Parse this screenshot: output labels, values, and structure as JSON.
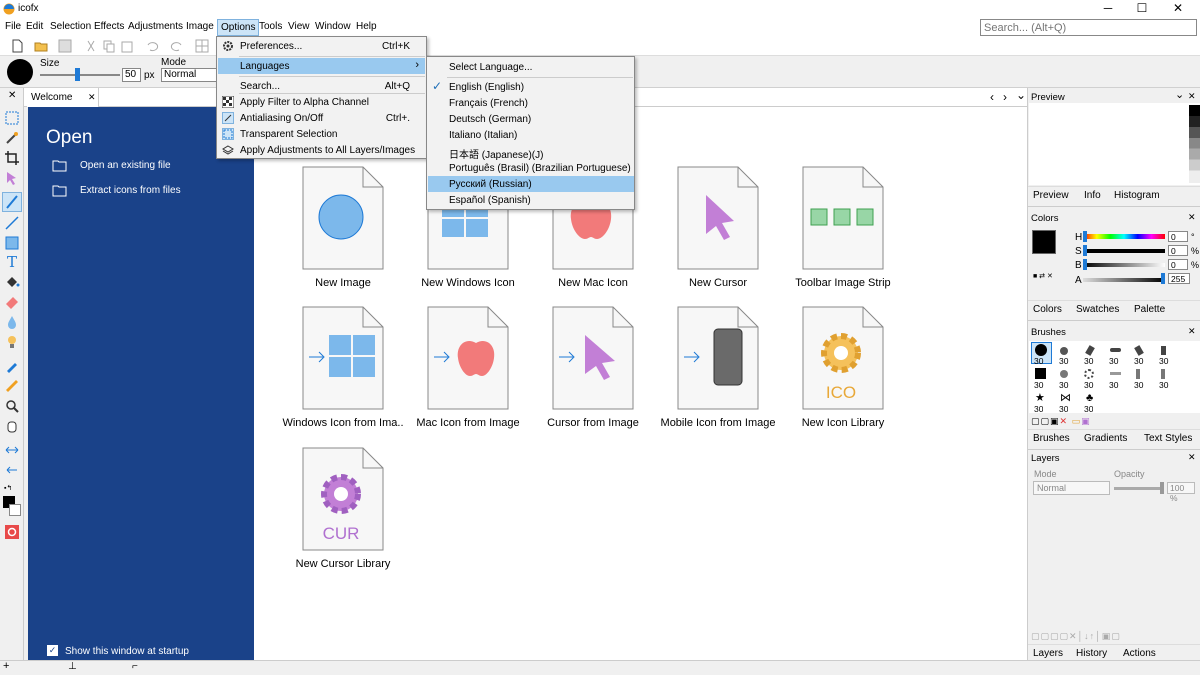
{
  "app": {
    "title": "icofx"
  },
  "window_controls": {
    "minimize": "─",
    "maximize": "☐",
    "close": "✕"
  },
  "menu": [
    "File",
    "Edit",
    "Selection",
    "Effects",
    "Adjustments",
    "Image",
    "Options",
    "Tools",
    "View",
    "Window",
    "Help"
  ],
  "search": {
    "placeholder": "Search... (Alt+Q)"
  },
  "props": {
    "size_label": "Size",
    "size_value": "50",
    "size_unit": "px",
    "mode_label": "Mode",
    "mode_value": "Normal"
  },
  "tabs": {
    "welcome": "Welcome",
    "welcome_close": "✕",
    "nav_left": "‹",
    "nav_right": "›",
    "nav_down": "⌄"
  },
  "sidebar": {
    "heading": "Open",
    "open_existing": "Open an existing file",
    "extract_icons": "Extract icons from files",
    "startup_label": "Show this window at startup",
    "startup_checked": true
  },
  "cards": [
    {
      "label": "New Image",
      "icon": "circle-icon"
    },
    {
      "label": "New Windows Icon",
      "icon": "windows-logo-icon"
    },
    {
      "label": "New Mac Icon",
      "icon": "apple-logo-icon"
    },
    {
      "label": "New Cursor",
      "icon": "cursor-icon"
    },
    {
      "label": "Toolbar Image Strip",
      "icon": "strip-icon"
    },
    {
      "label": "Windows Icon from Ima..",
      "icon": "windows-from-image-icon"
    },
    {
      "label": "Mac Icon from Image",
      "icon": "apple-from-image-icon"
    },
    {
      "label": "Cursor from Image",
      "icon": "cursor-from-image-icon"
    },
    {
      "label": "Mobile Icon from Image",
      "icon": "mobile-from-image-icon"
    },
    {
      "label": "New Icon Library",
      "icon": "ico-gear-icon"
    },
    {
      "label": "New Cursor Library",
      "icon": "cur-gear-icon"
    }
  ],
  "library_tags": {
    "ico": "ICO",
    "cur": "CUR"
  },
  "options_menu": [
    {
      "label": "Preferences...",
      "shortcut": "Ctrl+K",
      "icon": "gear-icon"
    },
    {
      "label": "Languages",
      "shortcut": "›",
      "icon": ""
    },
    {
      "label": "Search...",
      "shortcut": "Alt+Q",
      "icon": ""
    },
    {
      "label": "Apply Filter to Alpha Channel",
      "shortcut": "",
      "icon": "checker-icon"
    },
    {
      "label": "Antialiasing On/Off",
      "shortcut": "Ctrl+.",
      "icon": "antialias-icon"
    },
    {
      "label": "Transparent Selection",
      "shortcut": "",
      "icon": "transparent-selection-icon"
    },
    {
      "label": "Apply Adjustments to All Layers/Images",
      "shortcut": "",
      "icon": "layers-icon"
    }
  ],
  "languages_menu": [
    {
      "label": "Select Language...",
      "checked": false
    },
    {
      "label": "English (English)",
      "checked": true
    },
    {
      "label": "Français (French)",
      "checked": false
    },
    {
      "label": "Deutsch (German)",
      "checked": false
    },
    {
      "label": "Italiano (Italian)",
      "checked": false
    },
    {
      "label": "日本語 (Japanese)(J)",
      "checked": false
    },
    {
      "label": "Português (Brasil) (Brazilian Portuguese)",
      "checked": false
    },
    {
      "label": "Русский (Russian)",
      "checked": false
    },
    {
      "label": "Español (Spanish)",
      "checked": false
    }
  ],
  "right_panel": {
    "preview_title": "Preview",
    "preview_tabs": [
      "Preview",
      "Info",
      "Histogram"
    ],
    "colors_title": "Colors",
    "channels": [
      {
        "name": "H",
        "value": "0",
        "unit": "°"
      },
      {
        "name": "S",
        "value": "0",
        "unit": "%"
      },
      {
        "name": "B",
        "value": "0",
        "unit": "%"
      },
      {
        "name": "A",
        "value": "255",
        "unit": ""
      }
    ],
    "colors_tabs": [
      "Colors",
      "Swatches",
      "Palette"
    ],
    "brushes_title": "Brushes",
    "brush_sizes": [
      "30",
      "30",
      "30",
      "30",
      "30",
      "30",
      "30",
      "30",
      "30",
      "30",
      "30",
      "30",
      "30",
      "30",
      "30"
    ],
    "brushes_tabs": [
      "Brushes",
      "Gradients",
      "Text Styles"
    ],
    "layers_title": "Layers",
    "layers_mode_label": "Mode",
    "layers_mode_value": "Normal",
    "layers_opacity_label": "Opacity",
    "layers_opacity_value": "100 %",
    "layers_tabs": [
      "Layers",
      "History",
      "Actions"
    ]
  },
  "panel_close": "✕",
  "panel_chevron": "⌄",
  "colors": {
    "accent": "#1a4289",
    "menu_highlight": "#99c9ef",
    "cursor_purple": "#c27fd6",
    "blue_icon": "#7cb8eb",
    "green_icon": "#98d6a6",
    "apple_red": "#f27a7a",
    "gear_orange": "#f5c15b"
  }
}
